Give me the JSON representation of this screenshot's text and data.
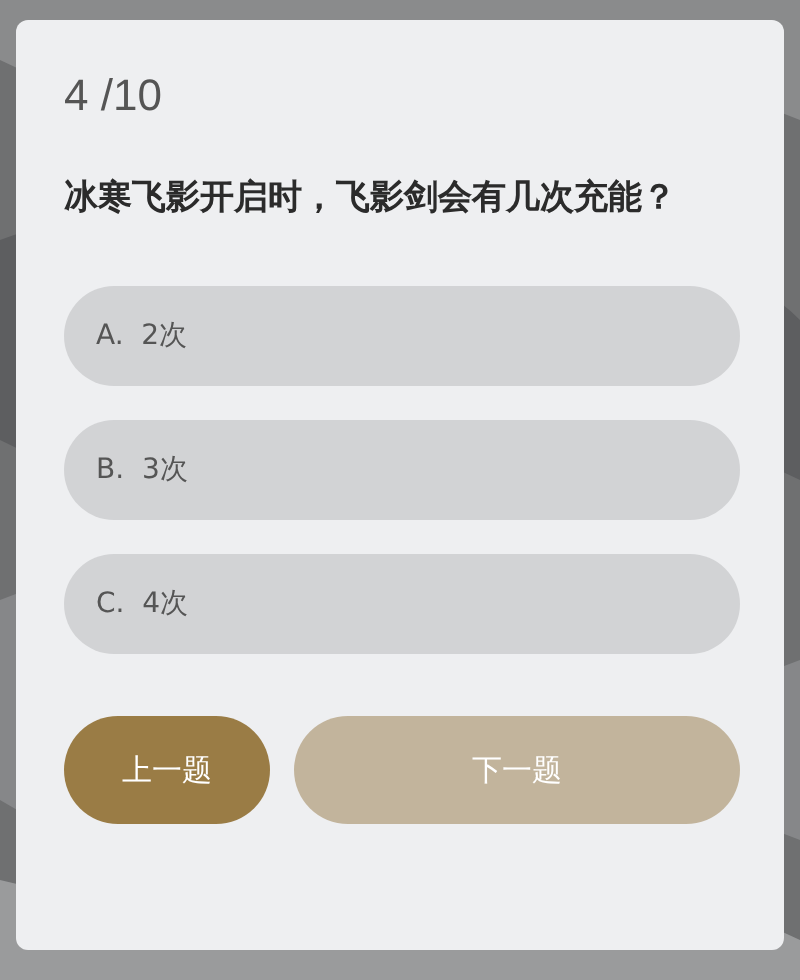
{
  "progress": "4 /10",
  "question": "冰寒飞影开启时，飞影剑会有几次充能？",
  "options": [
    {
      "letter": "A.",
      "text": "2次",
      "selected": false
    },
    {
      "letter": "B.",
      "text": "3次",
      "selected": false
    },
    {
      "letter": "C.",
      "text": "4次",
      "selected": false
    }
  ],
  "buttons": [
    {
      "label": "上一题",
      "disabled": false
    },
    {
      "label": "下一题",
      "disabled": true
    }
  ]
}
